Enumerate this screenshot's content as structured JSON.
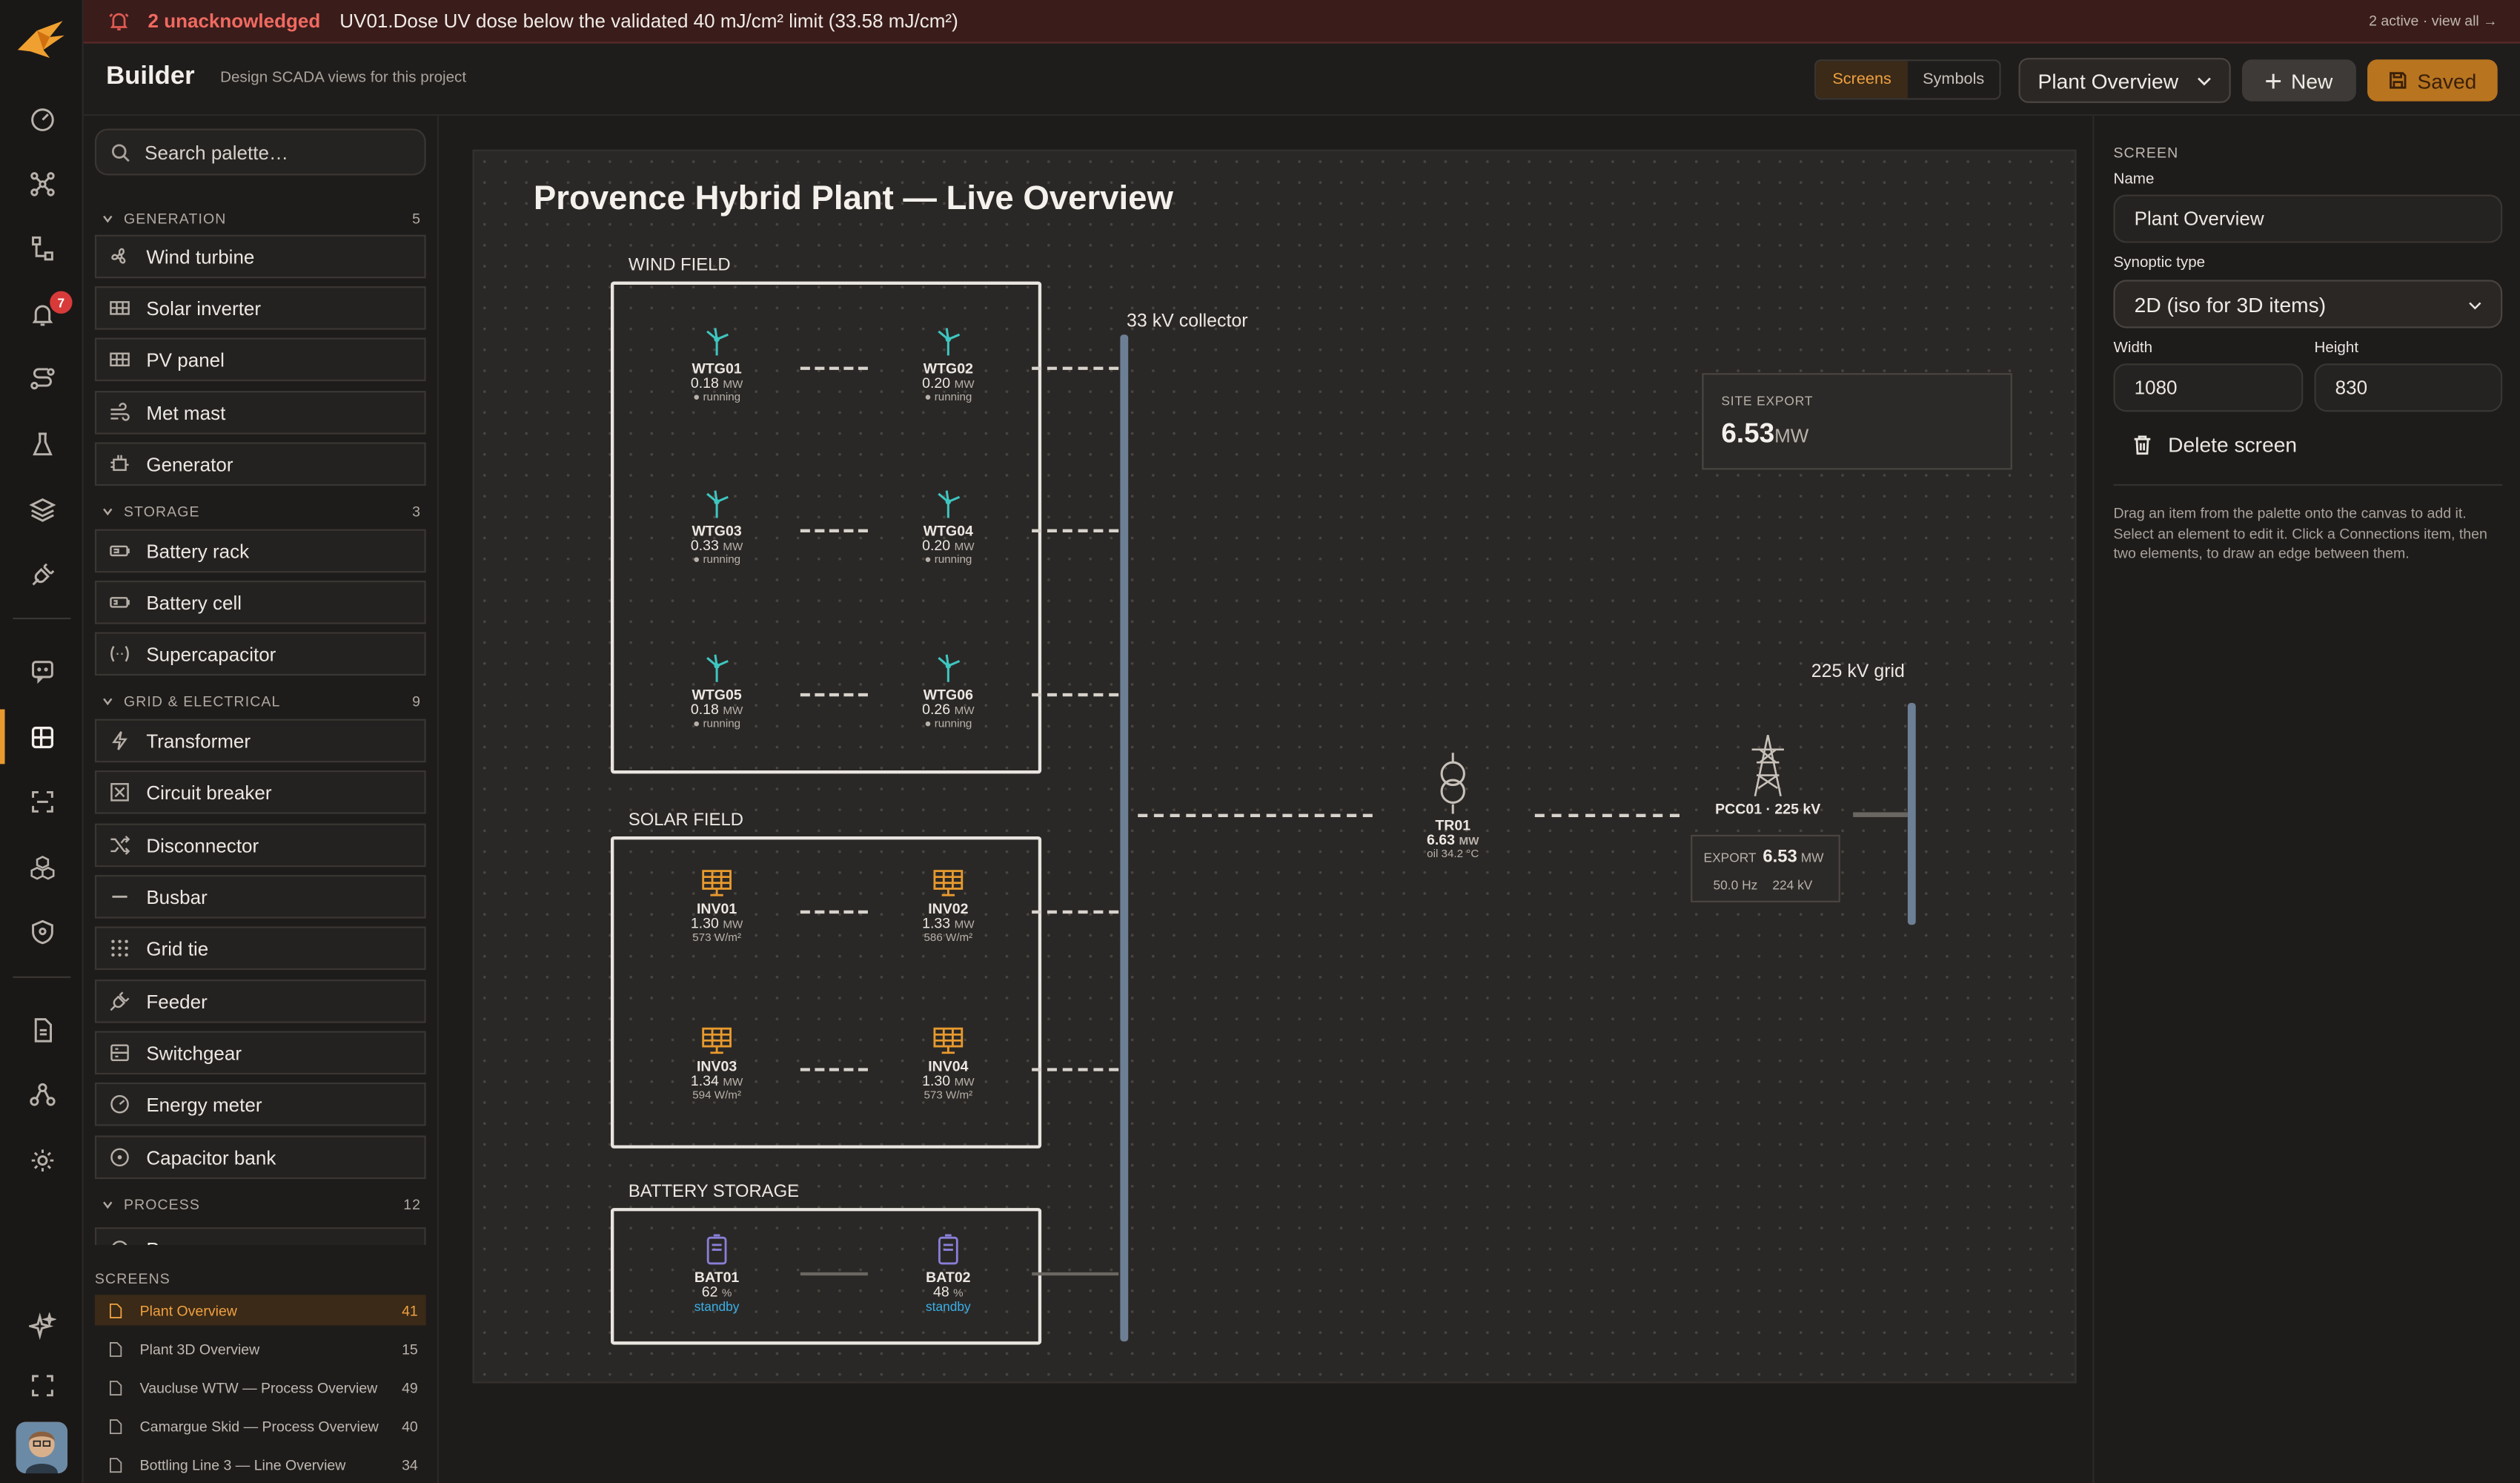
{
  "alarm": {
    "unack_label": "2 unacknowledged",
    "message": "UV01.Dose UV dose below the validated 40 mJ/cm² limit (33.58 mJ/cm²)",
    "view_all": "2 active · view all →"
  },
  "rail": {
    "alarm_badge": "7"
  },
  "header": {
    "title": "Builder",
    "subtitle": "Design SCADA views for this project",
    "seg_screens": "Screens",
    "seg_symbols": "Symbols",
    "screen_select": "Plant Overview",
    "new_label": "New",
    "saved_label": "Saved"
  },
  "palette": {
    "search_placeholder": "Search palette…",
    "categories": [
      {
        "name": "GENERATION",
        "count": "5",
        "items": [
          "Wind turbine",
          "Solar inverter",
          "PV panel",
          "Met mast",
          "Generator"
        ]
      },
      {
        "name": "STORAGE",
        "count": "3",
        "items": [
          "Battery rack",
          "Battery cell",
          "Supercapacitor"
        ]
      },
      {
        "name": "GRID & ELECTRICAL",
        "count": "9",
        "items": [
          "Transformer",
          "Circuit breaker",
          "Disconnector",
          "Busbar",
          "Grid tie",
          "Feeder",
          "Switchgear",
          "Energy meter",
          "Capacitor bank"
        ]
      },
      {
        "name": "PROCESS",
        "count": "12",
        "items": [
          "Pump"
        ]
      }
    ]
  },
  "screens": {
    "heading": "SCREENS",
    "items": [
      {
        "name": "Plant Overview",
        "count": "41"
      },
      {
        "name": "Plant 3D Overview",
        "count": "15"
      },
      {
        "name": "Vaucluse WTW — Process Overview",
        "count": "49"
      },
      {
        "name": "Camargue Skid — Process Overview",
        "count": "40"
      },
      {
        "name": "Bottling Line 3 — Line Overview",
        "count": "34"
      }
    ]
  },
  "canvas": {
    "title": "Provence Hybrid Plant — Live Overview",
    "wind_label": "WIND FIELD",
    "solar_label": "SOLAR FIELD",
    "battery_label": "BATTERY STORAGE",
    "collector_label": "33 kV collector",
    "grid_label": "225 kV grid",
    "site_export_label": "SITE EXPORT",
    "site_export_value": "6.53",
    "site_export_unit": "MW",
    "turbines": [
      {
        "name": "WTG01",
        "value": "0.18",
        "unit": "MW",
        "status": "● running"
      },
      {
        "name": "WTG02",
        "value": "0.20",
        "unit": "MW",
        "status": "● running"
      },
      {
        "name": "WTG03",
        "value": "0.33",
        "unit": "MW",
        "status": "● running"
      },
      {
        "name": "WTG04",
        "value": "0.20",
        "unit": "MW",
        "status": "● running"
      },
      {
        "name": "WTG05",
        "value": "0.18",
        "unit": "MW",
        "status": "● running"
      },
      {
        "name": "WTG06",
        "value": "0.26",
        "unit": "MW",
        "status": "● running"
      }
    ],
    "inverters": [
      {
        "name": "INV01",
        "value": "1.30",
        "unit": "MW",
        "irr": "573 W/m²"
      },
      {
        "name": "INV02",
        "value": "1.33",
        "unit": "MW",
        "irr": "586 W/m²"
      },
      {
        "name": "INV03",
        "value": "1.34",
        "unit": "MW",
        "irr": "594 W/m²"
      },
      {
        "name": "INV04",
        "value": "1.30",
        "unit": "MW",
        "irr": "573 W/m²"
      }
    ],
    "batteries": [
      {
        "name": "BAT01",
        "value": "62",
        "unit": "%",
        "status": "standby"
      },
      {
        "name": "BAT02",
        "value": "48",
        "unit": "%",
        "status": "standby"
      }
    ],
    "transformer": {
      "name": "TR01",
      "value": "6.63",
      "unit": "MW",
      "oil": "oil 34.2 °C"
    },
    "pcc": {
      "name": "PCC01 · 225 kV",
      "export_label": "EXPORT",
      "export_value": "6.53",
      "export_unit": "MW",
      "freq": "50.0 Hz",
      "volt": "224 kV"
    }
  },
  "inspector": {
    "heading": "SCREEN",
    "name_label": "Name",
    "name_value": "Plant Overview",
    "type_label": "Synoptic type",
    "type_value": "2D (iso for 3D items)",
    "width_label": "Width",
    "width_value": "1080",
    "height_label": "Height",
    "height_value": "830",
    "delete_label": "Delete screen",
    "help": "Drag an item from the palette onto the canvas to add it. Select an element to edit it. Click a Connections item, then two elements, to draw an edge between them."
  },
  "colors": {
    "accent": "#e89a2e",
    "alarm": "#f06a60",
    "turbine": "#3ec6c0",
    "solar": "#e89a2e",
    "battery": "#8a7fd8",
    "busbar": "#6d7f94"
  }
}
